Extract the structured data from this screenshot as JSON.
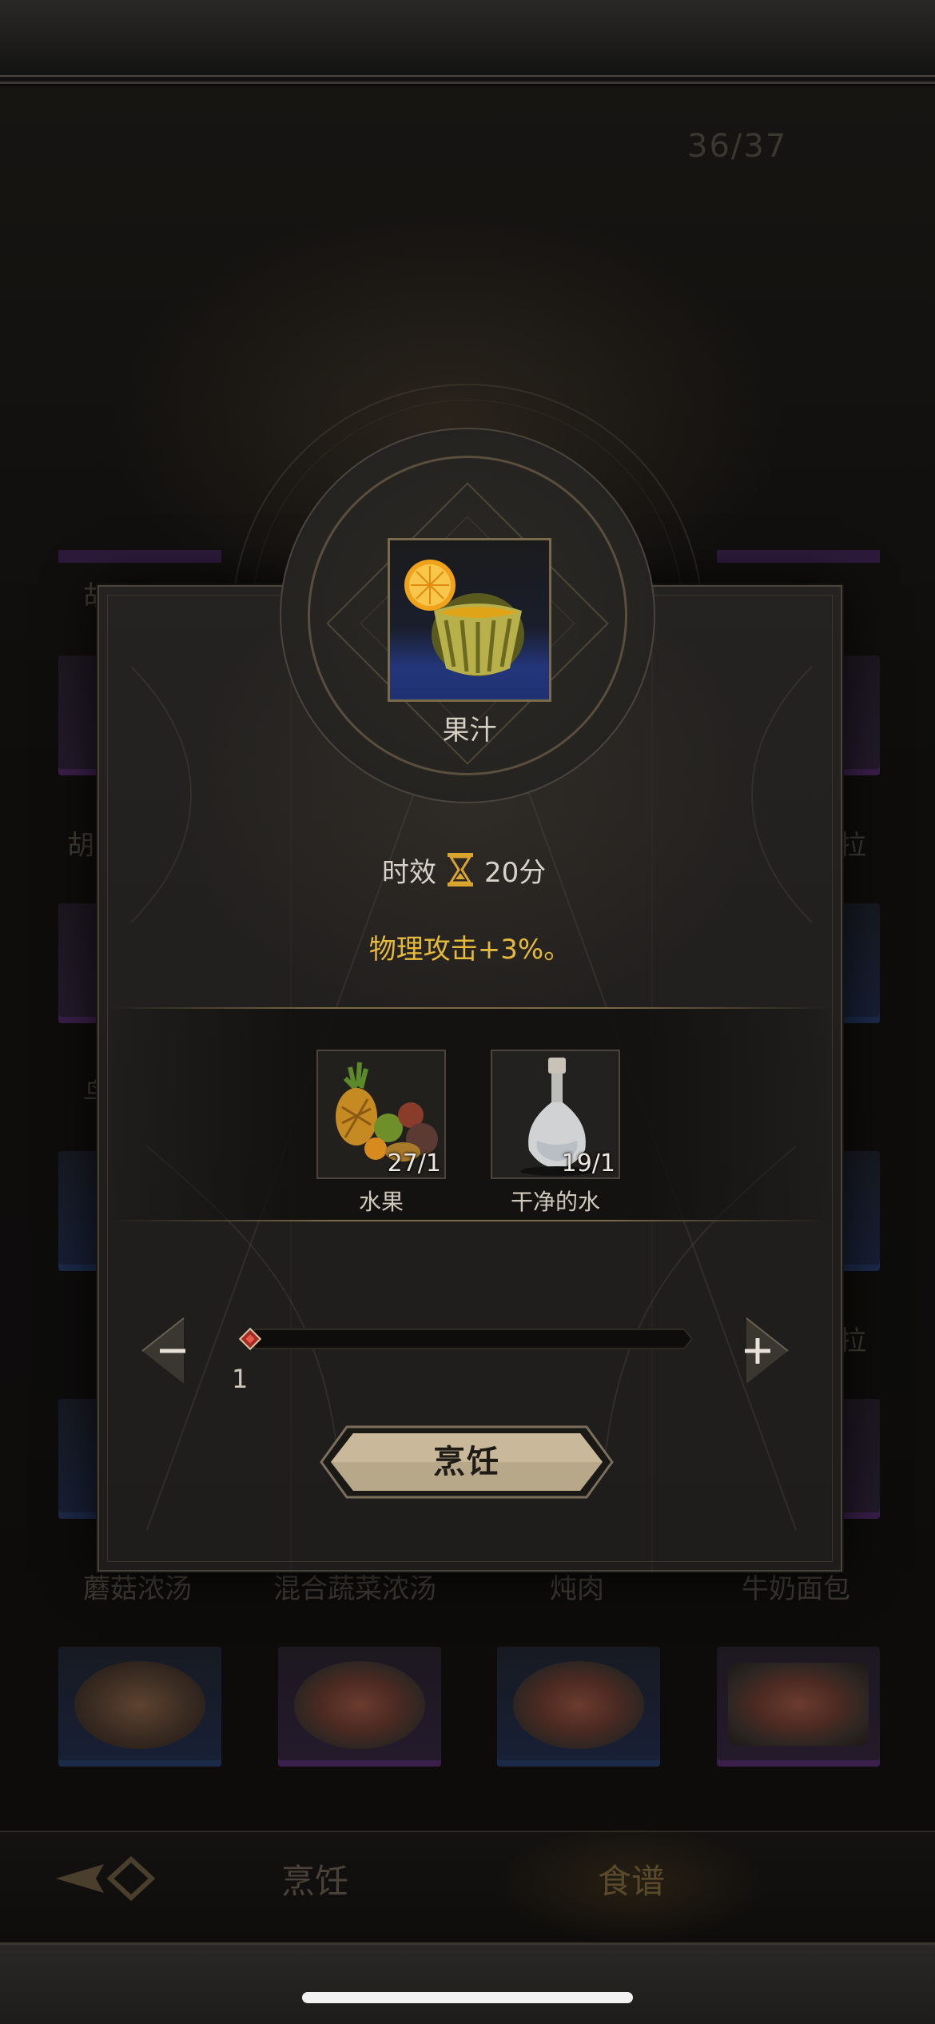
{
  "background": {
    "counter": "36/37",
    "labels_row_top": [
      "胡",
      "",
      "",
      ""
    ],
    "labels_row_1": [
      "胡",
      "拉"
    ],
    "labels_row_2": [
      "鸟"
    ],
    "labels_row_4": [
      "拉"
    ],
    "bottom_row_labels": [
      "蘑菇浓汤",
      "混合蔬菜浓汤",
      "炖肉",
      "牛奶面包"
    ],
    "nav": {
      "cook_tab": "烹饪",
      "recipe_tab": "食谱"
    }
  },
  "modal": {
    "item_name": "果汁",
    "duration_label": "时效",
    "duration_value": "20分",
    "effect_text": "物理攻击+3%。",
    "ingredients": [
      {
        "name": "水果",
        "count": "27/1"
      },
      {
        "name": "干净的水",
        "count": "19/1"
      }
    ],
    "quantity": "1",
    "quantity_fraction": 0,
    "decrease_symbol": "−",
    "increase_symbol": "+",
    "cook_button": "烹饪"
  },
  "colors": {
    "effect_text": "#e6b93a",
    "accent_gold": "#7a6a48",
    "slider_thumb": "#c0302a"
  }
}
